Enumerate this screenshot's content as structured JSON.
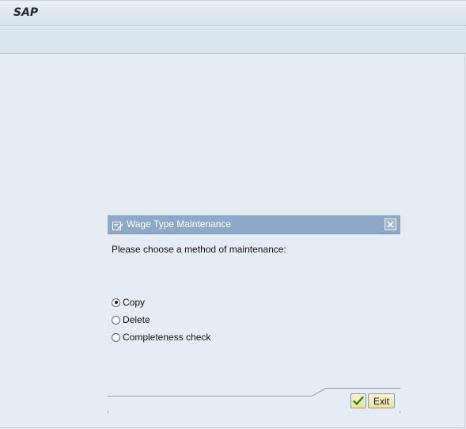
{
  "app": {
    "title": "SAP"
  },
  "dialog": {
    "title": "Wage Type Maintenance",
    "prompt": "Please choose a method of maintenance:",
    "options": [
      {
        "label": "Copy",
        "selected": true
      },
      {
        "label": "Delete",
        "selected": false
      },
      {
        "label": "Completeness check",
        "selected": false
      }
    ],
    "buttons": {
      "ok_icon": "checkmark-icon",
      "exit_label": "Exit"
    }
  },
  "colors": {
    "background": "#e5ecf3",
    "dialog_header": "#8ea8c7",
    "button_fill": "#ecdfa3",
    "checkmark": "#2e8b1f"
  }
}
